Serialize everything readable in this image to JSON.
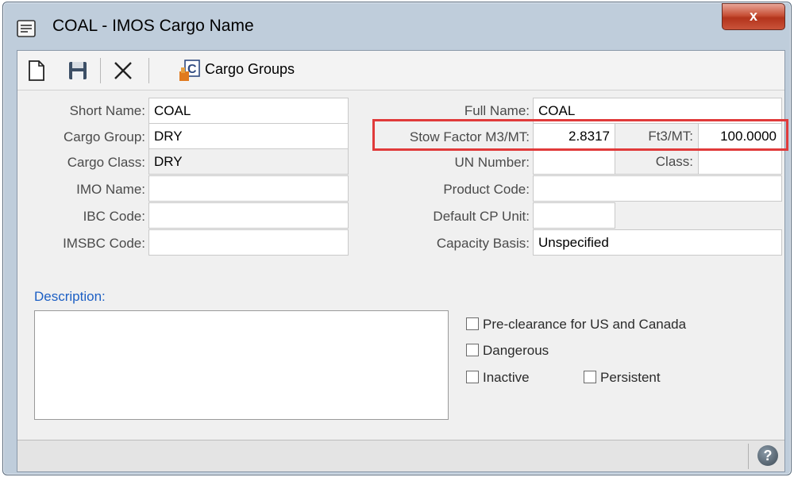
{
  "window": {
    "title": "COAL - IMOS Cargo Name",
    "close_label": "x"
  },
  "toolbar": {
    "icons": [
      "new-document-icon",
      "save-icon",
      "delete-icon",
      "cargo-groups-icon"
    ],
    "cargo_groups_label": "Cargo Groups"
  },
  "form": {
    "short_name": {
      "label": "Short Name:",
      "value": "COAL"
    },
    "cargo_group": {
      "label": "Cargo Group:",
      "value": "DRY"
    },
    "cargo_class": {
      "label": "Cargo Class:",
      "value": "DRY"
    },
    "imo_name": {
      "label": "IMO Name:",
      "value": ""
    },
    "ibc_code": {
      "label": "IBC Code:",
      "value": ""
    },
    "imsbc_code": {
      "label": "IMSBC Code:",
      "value": ""
    },
    "full_name": {
      "label": "Full Name:",
      "value": "COAL"
    },
    "stow_factor_m3": {
      "label": "Stow Factor M3/MT:",
      "value": "2.8317"
    },
    "stow_factor_ft3": {
      "label": "Ft3/MT:",
      "value": "100.0000"
    },
    "un_number": {
      "label": "UN Number:",
      "value": ""
    },
    "class": {
      "label": "Class:",
      "value": ""
    },
    "product_code": {
      "label": "Product Code:",
      "value": ""
    },
    "default_cp_unit": {
      "label": "Default CP Unit:",
      "value": ""
    },
    "capacity_basis": {
      "label": "Capacity Basis:",
      "value": "Unspecified"
    },
    "description": {
      "label": "Description:",
      "value": ""
    }
  },
  "checkboxes": {
    "pre_clearance": {
      "label": "Pre-clearance for US and Canada",
      "checked": false
    },
    "dangerous": {
      "label": "Dangerous",
      "checked": false
    },
    "inactive": {
      "label": "Inactive",
      "checked": false
    },
    "persistent": {
      "label": "Persistent",
      "checked": false
    }
  },
  "colors": {
    "highlight": "#e03a3a",
    "description_label": "#1c5fc4",
    "title_bar": "#bfcddb",
    "close_button": "#c75036"
  }
}
